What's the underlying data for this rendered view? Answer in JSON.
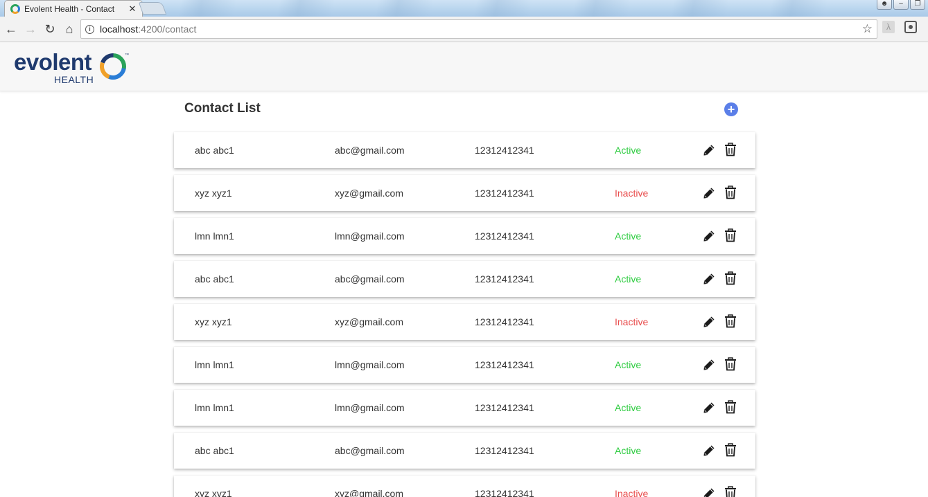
{
  "browser": {
    "tab_title": "Evolent Health - Contact",
    "tab_close": "✕",
    "url_host": "localhost",
    "url_rest": ":4200/contact"
  },
  "app": {
    "logo_word": "evolent",
    "logo_sub": "HEALTH",
    "logo_tm": "™",
    "brand_color": "#1f3a6e"
  },
  "page": {
    "title": "Contact List",
    "add_icon": "plus-circle-icon",
    "accent_color": "#5b7fe8"
  },
  "status_colors": {
    "active": "#2ecc40",
    "inactive": "#e84c4c"
  },
  "contacts": [
    {
      "name": "abc abc1",
      "email": "abc@gmail.com",
      "phone": "12312412341",
      "status": "Active"
    },
    {
      "name": "xyz xyz1",
      "email": "xyz@gmail.com",
      "phone": "12312412341",
      "status": "Inactive"
    },
    {
      "name": "lmn lmn1",
      "email": "lmn@gmail.com",
      "phone": "12312412341",
      "status": "Active"
    },
    {
      "name": "abc abc1",
      "email": "abc@gmail.com",
      "phone": "12312412341",
      "status": "Active"
    },
    {
      "name": "xyz xyz1",
      "email": "xyz@gmail.com",
      "phone": "12312412341",
      "status": "Inactive"
    },
    {
      "name": "lmn lmn1",
      "email": "lmn@gmail.com",
      "phone": "12312412341",
      "status": "Active"
    },
    {
      "name": "lmn lmn1",
      "email": "lmn@gmail.com",
      "phone": "12312412341",
      "status": "Active"
    },
    {
      "name": "abc abc1",
      "email": "abc@gmail.com",
      "phone": "12312412341",
      "status": "Active"
    },
    {
      "name": "xyz xyz1",
      "email": "xyz@gmail.com",
      "phone": "12312412341",
      "status": "Inactive"
    }
  ]
}
